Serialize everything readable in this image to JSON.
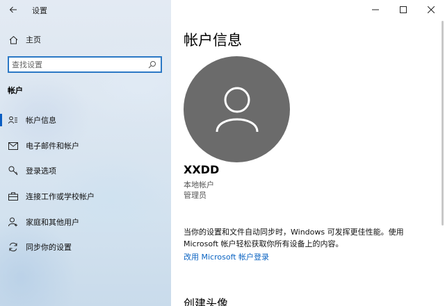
{
  "window": {
    "title": "设置",
    "controls": [
      "minimize",
      "maximize",
      "close"
    ]
  },
  "sidebar": {
    "home_label": "主页",
    "search_placeholder": "查找设置",
    "section_title": "帐户",
    "items": [
      {
        "label": "帐户信息",
        "icon": "account-info-icon",
        "selected": true
      },
      {
        "label": "电子邮件和帐户",
        "icon": "mail-icon",
        "selected": false
      },
      {
        "label": "登录选项",
        "icon": "key-icon",
        "selected": false
      },
      {
        "label": "连接工作或学校帐户",
        "icon": "briefcase-icon",
        "selected": false
      },
      {
        "label": "家庭和其他用户",
        "icon": "add-person-icon",
        "selected": false
      },
      {
        "label": "同步你的设置",
        "icon": "sync-icon",
        "selected": false
      }
    ]
  },
  "main": {
    "title": "帐户信息",
    "username": "XXDD",
    "account_type": "本地帐户",
    "account_role": "管理员",
    "description": "当你的设置和文件自动同步时，Windows 可发挥更佳性能。使用 Microsoft 帐户轻松获取你所有设备上的内容。",
    "link_label": "改用 Microsoft 帐户登录",
    "subheading": "创建头像"
  },
  "colors": {
    "accent": "#0a5dc2",
    "link": "#0a63c2",
    "avatar_bg": "#6b6b6b"
  }
}
